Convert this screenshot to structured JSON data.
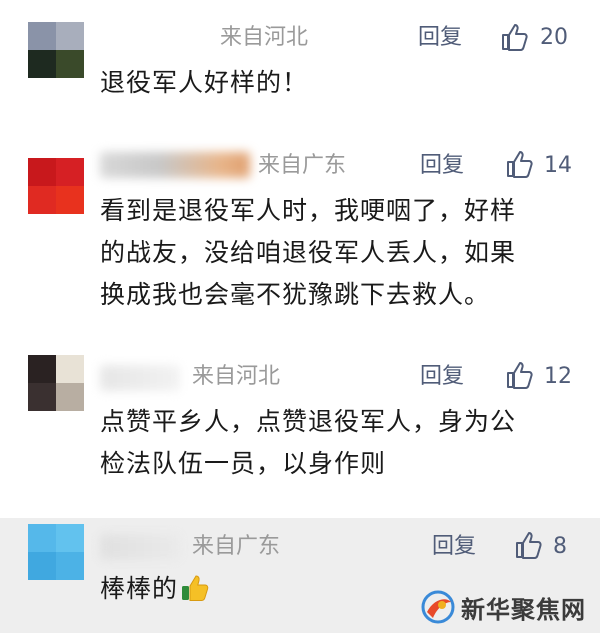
{
  "comments": [
    {
      "location": "来自河北",
      "reply_label": "回复",
      "likes": "20",
      "lines": [
        "退役军人好样的！"
      ],
      "avatar_colors": [
        "#8a93a8",
        "#a8aebc",
        "#1e2a20",
        "#3a4a2a"
      ]
    },
    {
      "location": "来自广东",
      "reply_label": "回复",
      "likes": "14",
      "lines": [
        "看到是退役军人时，我哽咽了，好样",
        "的战友，没给咱退役军人丢人，如果",
        "换成我也会毫不犹豫跳下去救人。"
      ],
      "avatar_colors": [
        "#c8181c",
        "#d62024",
        "#e02a22",
        "#e8321e"
      ]
    },
    {
      "location": "来自河北",
      "reply_label": "回复",
      "likes": "12",
      "lines": [
        "点赞平乡人，点赞退役军人，身为公",
        "检法队伍一员，以身作则"
      ],
      "avatar_colors": [
        "#2a2222",
        "#e8e2d6",
        "#3a3030",
        "#b8aea2"
      ]
    },
    {
      "location": "来自广东",
      "reply_label": "回复",
      "likes": "8",
      "lines": [
        "棒棒的"
      ],
      "avatar_colors": [
        "#55b8ea",
        "#62c2ee",
        "#40a8e0",
        "#4cb2e6"
      ]
    }
  ],
  "watermark": {
    "text": "新华聚焦网"
  },
  "colors": {
    "accent": "#505c78",
    "meta_gray": "#9a9a9a",
    "highlight_bg": "#eeeeee"
  }
}
